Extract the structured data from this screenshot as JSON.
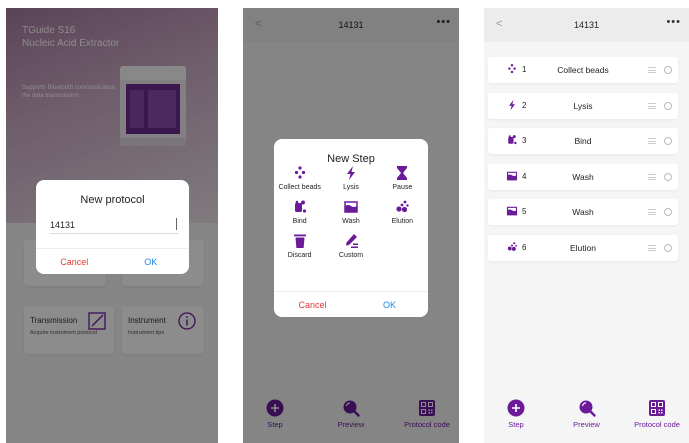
{
  "panel1": {
    "hero_title_line1": "TGuide S16",
    "hero_title_line2": "Nucleic Acid Extractor",
    "hero_subtitle": "Supports Bluetooth communication, the data transmission",
    "cards": [
      {
        "title": "Transmission",
        "subtitle": "Acquire instrument protocol",
        "icon": "edit-square-icon"
      },
      {
        "title": "Instrument",
        "subtitle": "Instrument tips",
        "icon": "info-circle-icon"
      }
    ],
    "dialog": {
      "title": "New protocol",
      "input_value": "14131",
      "cancel_label": "Cancel",
      "ok_label": "OK"
    }
  },
  "panel2": {
    "nav": {
      "back": "<",
      "title": "14131",
      "more": "•••"
    },
    "dialog": {
      "title": "New Step",
      "steps": [
        {
          "label": "Collect beads",
          "icon": "collect-beads-icon"
        },
        {
          "label": "Lysis",
          "icon": "lysis-icon"
        },
        {
          "label": "Pause",
          "icon": "pause-hourglass-icon"
        },
        {
          "label": "Bind",
          "icon": "bind-icon"
        },
        {
          "label": "Wash",
          "icon": "wash-icon"
        },
        {
          "label": "Elution",
          "icon": "elution-icon"
        },
        {
          "label": "Discard",
          "icon": "discard-icon"
        },
        {
          "label": "Custom",
          "icon": "custom-icon"
        }
      ],
      "cancel_label": "Cancel",
      "ok_label": "OK"
    },
    "toolbar": [
      {
        "label": "Step",
        "icon": "add-step-icon"
      },
      {
        "label": "Preview",
        "icon": "preview-search-icon"
      },
      {
        "label": "Protocol code",
        "icon": "qr-code-icon"
      }
    ]
  },
  "panel3": {
    "nav": {
      "back": "<",
      "title": "14131",
      "more": "•••"
    },
    "steps": [
      {
        "num": "1",
        "name": "Collect beads",
        "icon": "collect-beads-icon"
      },
      {
        "num": "2",
        "name": "Lysis",
        "icon": "lysis-icon"
      },
      {
        "num": "3",
        "name": "Bind",
        "icon": "bind-icon"
      },
      {
        "num": "4",
        "name": "Wash",
        "icon": "wash-icon"
      },
      {
        "num": "5",
        "name": "Wash",
        "icon": "wash-icon"
      },
      {
        "num": "6",
        "name": "Elution",
        "icon": "elution-icon"
      }
    ],
    "toolbar": [
      {
        "label": "Step",
        "icon": "add-step-icon"
      },
      {
        "label": "Preview",
        "icon": "preview-search-icon"
      },
      {
        "label": "Protocol code",
        "icon": "qr-code-icon"
      }
    ]
  },
  "colors": {
    "accent": "#6a1b9a",
    "cancel": "#e53935",
    "ok": "#1e88e5"
  }
}
